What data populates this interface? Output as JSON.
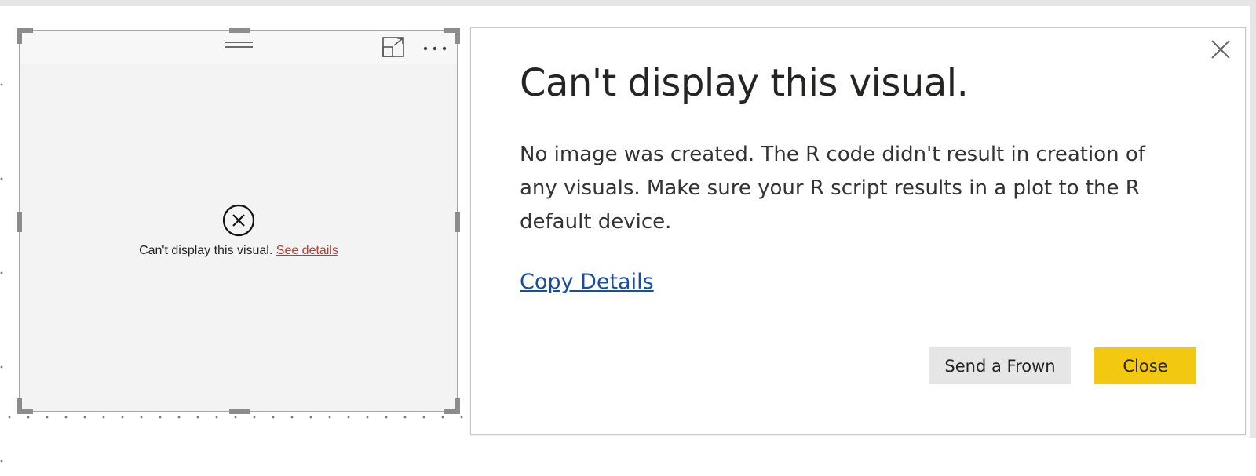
{
  "visual": {
    "error_message": "Can't display this visual.",
    "see_details_label": "See details"
  },
  "dialog": {
    "title": "Can't display this visual.",
    "body": "No image was created. The R code didn't result in creation of any visuals. Make sure your R script results in a plot to the R default device.",
    "copy_details_label": "Copy Details",
    "send_frown_label": "Send a Frown",
    "close_label": "Close"
  },
  "icons": {
    "focus": "focus-mode-icon",
    "more": "more-options-icon",
    "grip": "drag-grip-icon",
    "error": "error-circle-x-icon",
    "close": "close-icon"
  },
  "colors": {
    "close_button": "#f2c811",
    "frown_button": "#e6e6e6",
    "link": "#1a4d9c",
    "see_details": "#c0392b"
  }
}
